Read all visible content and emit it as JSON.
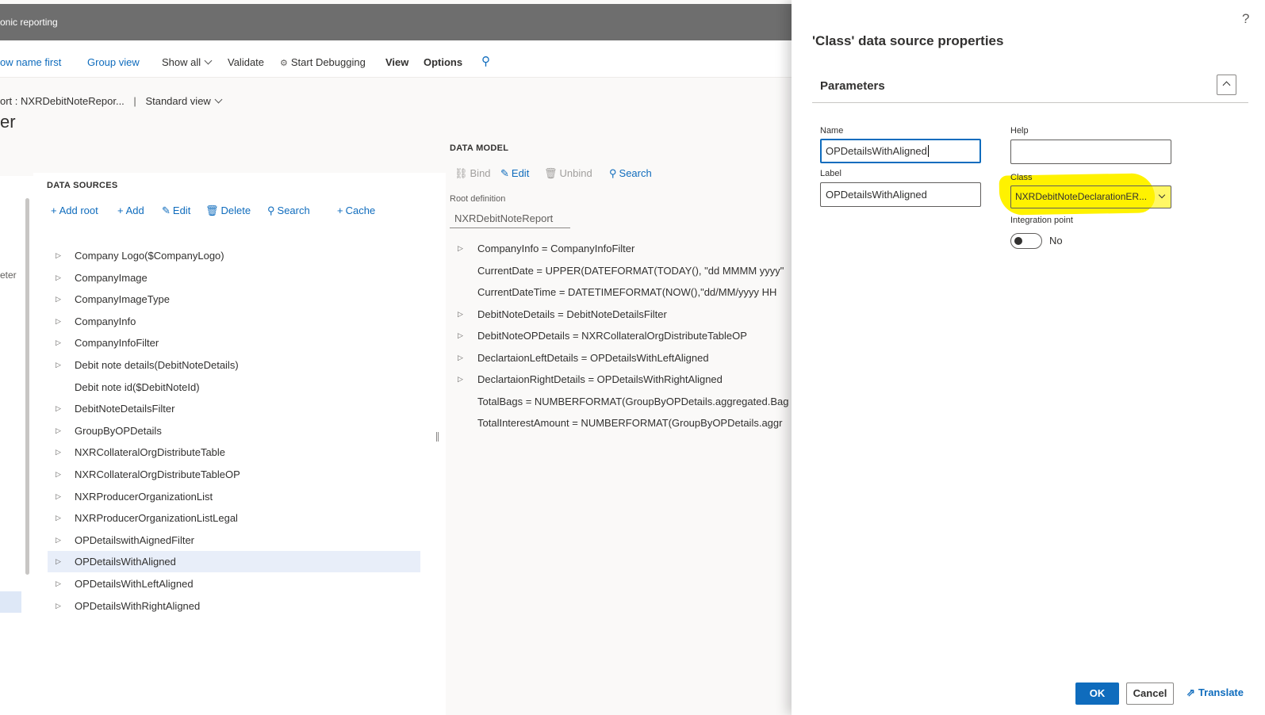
{
  "app": {
    "title": "onic reporting",
    "toolbar": {
      "show_name_first": "ow name first",
      "group_view": "Group view",
      "show_all": "Show all",
      "validate": "Validate",
      "start_debugging": "Start Debugging",
      "view": "View",
      "options": "Options"
    },
    "breadcrumb": "ort : NXRDebitNoteRepor...",
    "view_selector": "Standard view",
    "page_title": "er",
    "left_fragment": "eter"
  },
  "data_sources": {
    "heading": "DATA SOURCES",
    "actions": {
      "add_root": "Add root",
      "add": "Add",
      "edit": "Edit",
      "delete": "Delete",
      "search": "Search",
      "cache": "Cache"
    },
    "items": [
      {
        "label": "Company Logo($CompanyLogo)",
        "expandable": true
      },
      {
        "label": "CompanyImage",
        "expandable": true
      },
      {
        "label": "CompanyImageType",
        "expandable": true
      },
      {
        "label": "CompanyInfo",
        "expandable": true
      },
      {
        "label": "CompanyInfoFilter",
        "expandable": true
      },
      {
        "label": "Debit note details(DebitNoteDetails)",
        "expandable": true
      },
      {
        "label": "Debit note id($DebitNoteId)",
        "expandable": false
      },
      {
        "label": "DebitNoteDetailsFilter",
        "expandable": true
      },
      {
        "label": "GroupByOPDetails",
        "expandable": true
      },
      {
        "label": "NXRCollateralOrgDistributeTable",
        "expandable": true
      },
      {
        "label": "NXRCollateralOrgDistributeTableOP",
        "expandable": true
      },
      {
        "label": "NXRProducerOrganizationList",
        "expandable": true
      },
      {
        "label": "NXRProducerOrganizationListLegal",
        "expandable": true
      },
      {
        "label": "OPDetailswithAignedFilter",
        "expandable": true
      },
      {
        "label": "OPDetailsWithAligned",
        "expandable": true,
        "selected": true
      },
      {
        "label": "OPDetailsWithLeftAligned",
        "expandable": true
      },
      {
        "label": "OPDetailsWithRightAligned",
        "expandable": true
      }
    ]
  },
  "data_model": {
    "heading": "DATA MODEL",
    "actions": {
      "bind": "Bind",
      "edit": "Edit",
      "unbind": "Unbind",
      "search": "Search"
    },
    "root_label": "Root definition",
    "root_value": "NXRDebitNoteReport",
    "items": [
      {
        "label": "CompanyInfo = CompanyInfoFilter",
        "expandable": true
      },
      {
        "label": "CurrentDate = UPPER(DATEFORMAT(TODAY(), \"dd MMMM yyyy\"",
        "expandable": false
      },
      {
        "label": "CurrentDateTime = DATETIMEFORMAT(NOW(),\"dd/MM/yyyy HH",
        "expandable": false
      },
      {
        "label": "DebitNoteDetails = DebitNoteDetailsFilter",
        "expandable": true
      },
      {
        "label": "DebitNoteOPDetails = NXRCollateralOrgDistributeTableOP",
        "expandable": true
      },
      {
        "label": "DeclartaionLeftDetails = OPDetailsWithLeftAligned",
        "expandable": true
      },
      {
        "label": "DeclartaionRightDetails = OPDetailsWithRightAligned",
        "expandable": true
      },
      {
        "label": "TotalBags = NUMBERFORMAT(GroupByOPDetails.aggregated.Bag",
        "expandable": false
      },
      {
        "label": "TotalInterestAmount = NUMBERFORMAT(GroupByOPDetails.aggr",
        "expandable": false
      }
    ]
  },
  "dialog": {
    "help_glyph": "?",
    "title": "'Class' data source properties",
    "section": "Parameters",
    "name_label": "Name",
    "name_value": "OPDetailsWithAligned",
    "help_label": "Help",
    "help_value": "",
    "label_label": "Label",
    "label_value": "OPDetailsWithAligned",
    "class_label": "Class",
    "class_value": "NXRDebitNoteDeclarationER...",
    "integration_label": "Integration point",
    "integration_value": "No",
    "ok": "OK",
    "cancel": "Cancel",
    "translate": "Translate"
  },
  "colors": {
    "accent": "#0f6cbd",
    "topbar": "#6e6e6e",
    "highlight": "#fff200",
    "selected_row": "#e8eef9"
  }
}
